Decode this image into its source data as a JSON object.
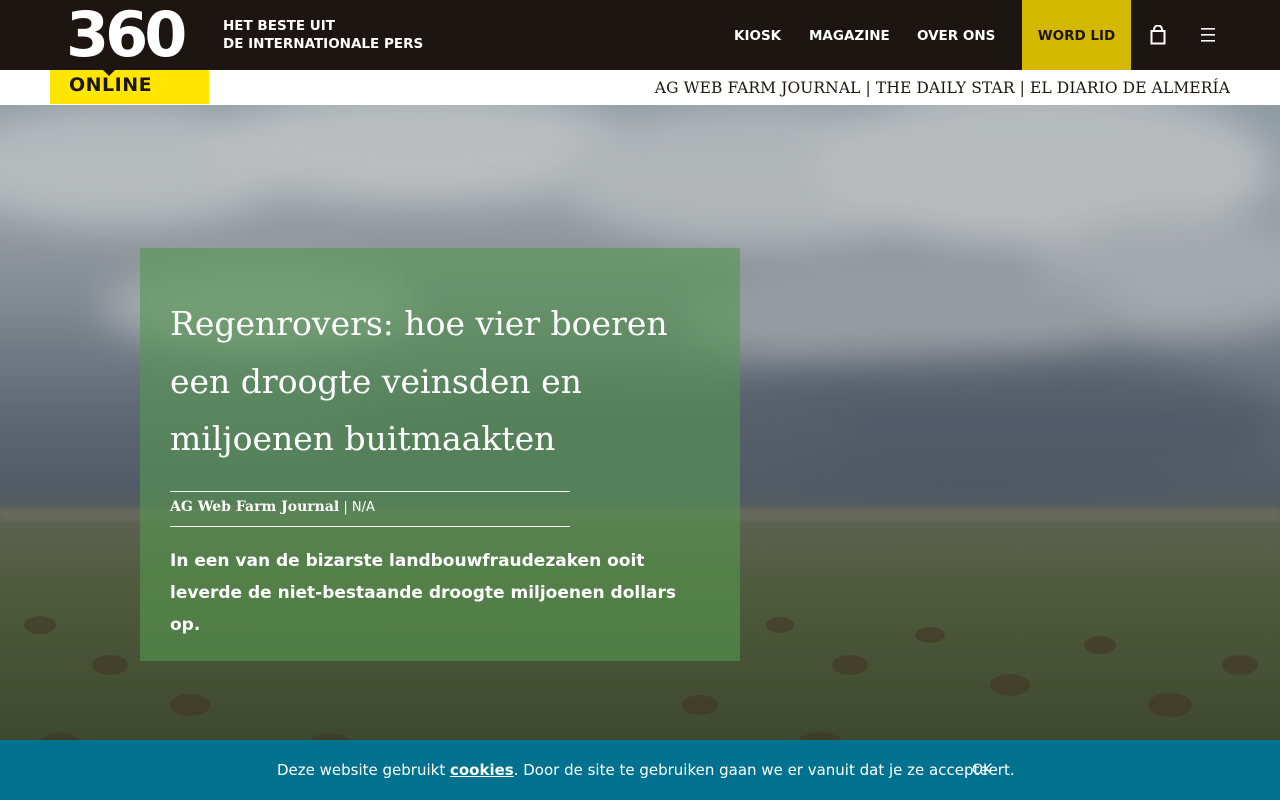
{
  "logo": {
    "number": "360",
    "subtitle": "ONLINE"
  },
  "header": {
    "tagline_line1": "HET BESTE UIT",
    "tagline_line2": "DE INTERNATIONALE PERS",
    "nav": {
      "kiosk": "KIOSK",
      "magazine": "MAGAZINE",
      "over_ons": "OVER ONS",
      "word_lid": "WORD LID"
    },
    "icons": [
      "shopping-bag-icon",
      "hamburger-menu-icon"
    ]
  },
  "sources_strip": {
    "text": "AG WEB FARM JOURNAL | THE DAILY STAR | EL DIARIO DE ALMERÍA"
  },
  "article": {
    "title": "Regenrovers: hoe vier boeren een droogte veinsden en miljoenen buitmaakten",
    "source": "AG Web Farm Journal",
    "separator": " | ",
    "date": "N/A",
    "lead": "In een van de bizarste landbouwfraudezaken ooit leverde de niet-bestaande droogte miljoenen dollars op."
  },
  "cookie_bar": {
    "text_before": "Deze website gebruikt ",
    "link_label": "cookies",
    "text_after": ". Door de site te gebruiken gaan we er vanuit dat je ze accepteert.",
    "ok_label": "OK"
  },
  "colors": {
    "header_bg": "#1c1512",
    "logo_yellow": "#ffe600",
    "cta_yellow": "#d4b800",
    "card_green": "#569650",
    "cookie_bg": "#007290"
  }
}
